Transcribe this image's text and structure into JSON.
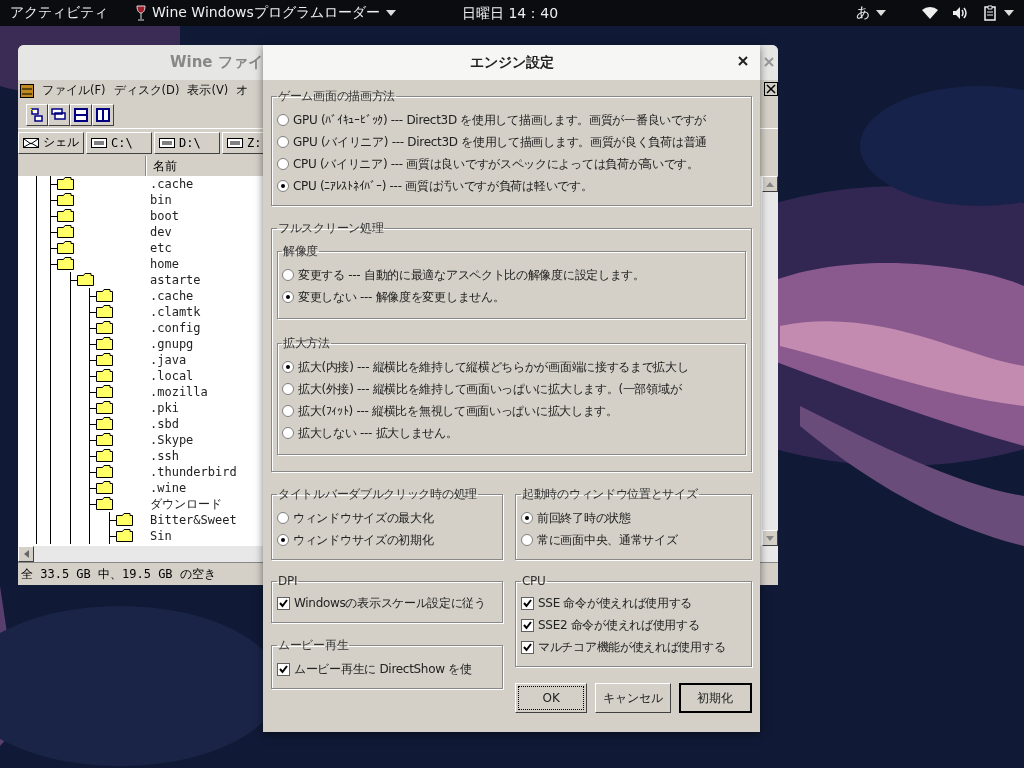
{
  "top_bar": {
    "activities": "アクティビティ",
    "app_menu": "Wine Windowsプログラムローダー",
    "clock": "日曜日 14：40",
    "input_method": "あ"
  },
  "file_window": {
    "title": "Wine ファイ",
    "menu": [
      "ファイル(F)",
      "ディスク(D)",
      "表示(V)",
      "オ"
    ],
    "drives": [
      "シェル",
      "C:\\",
      "D:\\",
      "Z:"
    ],
    "column": "名前",
    "tree": [
      {
        "name": ".cache"
      },
      {
        "name": "bin"
      },
      {
        "name": "boot"
      },
      {
        "name": "dev"
      },
      {
        "name": "etc"
      },
      {
        "name": "home",
        "children": [
          {
            "name": "astarte",
            "children": [
              {
                "name": ".cache"
              },
              {
                "name": ".clamtk"
              },
              {
                "name": ".config"
              },
              {
                "name": ".gnupg"
              },
              {
                "name": ".java"
              },
              {
                "name": ".local"
              },
              {
                "name": ".mozilla"
              },
              {
                "name": ".pki"
              },
              {
                "name": ".sbd"
              },
              {
                "name": ".Skype"
              },
              {
                "name": ".ssh"
              },
              {
                "name": ".thunderbird"
              },
              {
                "name": ".wine"
              },
              {
                "name": "ダウンロード",
                "children": [
                  {
                    "name": "Bitter&Sweet"
                  },
                  {
                    "name": "Sin"
                  }
                ]
              }
            ]
          }
        ]
      }
    ],
    "status": "全 33.5 GB 中、19.5 GB の空き"
  },
  "dialog": {
    "title": "エンジン設定",
    "render_group": {
      "legend": "ゲーム画面の描画方法",
      "options": [
        {
          "label": "GPU (ﾊﾞｲｷｭｰﾋﾞｯｸ) --- Direct3D を使用して描画します。画質が一番良いですが",
          "selected": false
        },
        {
          "label": "GPU (バイリニア) --- Direct3D を使用して描画します。画質が良く負荷は普通",
          "selected": false
        },
        {
          "label": "CPU (バイリニア) --- 画質は良いですがスペックによっては負荷が高いです。",
          "selected": false
        },
        {
          "label": "CPU (ﾆｱﾚｽﾄﾈｲﾊﾞｰ) --- 画質は汚いですが負荷は軽いです。",
          "selected": true
        }
      ]
    },
    "fullscreen_group": {
      "legend": "フルスクリーン処理",
      "subgroups": [
        {
          "legend": "解像度",
          "options": [
            {
              "label": "変更する --- 自動的に最適なアスペクト比の解像度に設定します。",
              "selected": false
            },
            {
              "label": "変更しない --- 解像度を変更しません。",
              "selected": true
            }
          ]
        },
        {
          "legend": "拡大方法",
          "options": [
            {
              "label": "拡大(内接) --- 縦横比を維持して縦横どちらかが画面端に接するまで拡大し",
              "selected": true
            },
            {
              "label": "拡大(外接) --- 縦横比を維持して画面いっぱいに拡大します。(一部領域が",
              "selected": false
            },
            {
              "label": "拡大(ﾌｨｯﾄ) --- 縦横比を無視して画面いっぱいに拡大します。",
              "selected": false
            },
            {
              "label": "拡大しない --- 拡大しません。",
              "selected": false
            }
          ]
        }
      ]
    },
    "left_column": [
      {
        "legend": "タイトルバーダブルクリック時の処理",
        "kind": "radio",
        "options": [
          {
            "label": "ウィンドウサイズの最大化",
            "selected": false
          },
          {
            "label": "ウィンドウサイズの初期化",
            "selected": true
          }
        ]
      },
      {
        "legend": "DPI",
        "kind": "checkbox",
        "options": [
          {
            "label": "Windowsの表示スケール設定に従う",
            "checked": true
          }
        ]
      },
      {
        "legend": "ムービー再生",
        "kind": "checkbox",
        "options": [
          {
            "label": "ムービー再生に DirectShow を使",
            "checked": true
          }
        ]
      }
    ],
    "right_column": [
      {
        "legend": "起動時のウィンドウ位置とサイズ",
        "kind": "radio",
        "options": [
          {
            "label": "前回終了時の状態",
            "selected": true
          },
          {
            "label": "常に画面中央、通常サイズ",
            "selected": false
          }
        ]
      },
      {
        "legend": "CPU",
        "kind": "checkbox",
        "options": [
          {
            "label": "SSE 命令が使えれば使用する",
            "checked": true
          },
          {
            "label": "SSE2 命令が使えれば使用する",
            "checked": true
          },
          {
            "label": "マルチコア機能が使えれば使用する",
            "checked": true
          }
        ]
      }
    ],
    "buttons": [
      {
        "label": "OK",
        "focused": true,
        "default": false
      },
      {
        "label": "キャンセル",
        "focused": false,
        "default": false
      },
      {
        "label": "初期化",
        "focused": false,
        "default": true
      }
    ]
  }
}
